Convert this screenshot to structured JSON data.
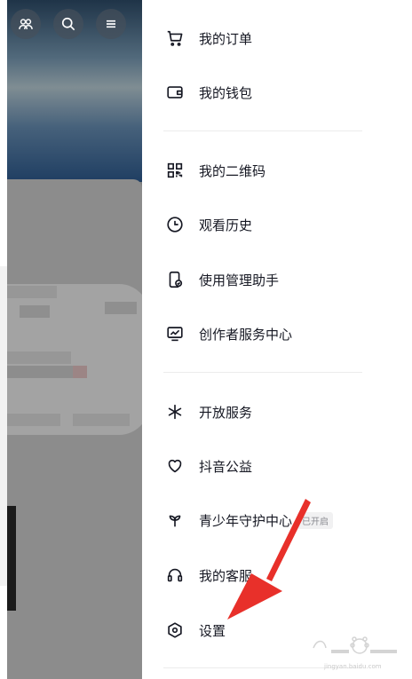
{
  "top_icons": [
    {
      "name": "friends-icon"
    },
    {
      "name": "search-icon"
    },
    {
      "name": "menu-icon"
    }
  ],
  "menu": {
    "group1": [
      {
        "id": "orders",
        "label": "我的订单",
        "icon": "cart-icon"
      },
      {
        "id": "wallet",
        "label": "我的钱包",
        "icon": "wallet-icon"
      }
    ],
    "group2": [
      {
        "id": "qrcode",
        "label": "我的二维码",
        "icon": "qrcode-icon"
      },
      {
        "id": "history",
        "label": "观看历史",
        "icon": "clock-icon"
      },
      {
        "id": "usage",
        "label": "使用管理助手",
        "icon": "phone-check-icon"
      },
      {
        "id": "creator",
        "label": "创作者服务中心",
        "icon": "monitor-chart-icon"
      }
    ],
    "group3": [
      {
        "id": "open-service",
        "label": "开放服务",
        "icon": "asterisk-icon"
      },
      {
        "id": "charity",
        "label": "抖音公益",
        "icon": "heart-icon"
      },
      {
        "id": "youth",
        "label": "青少年守护中心",
        "icon": "sprout-icon",
        "badge": "已开启"
      },
      {
        "id": "support",
        "label": "我的客服",
        "icon": "headset-icon"
      },
      {
        "id": "settings",
        "label": "设置",
        "icon": "hexagon-settings-icon"
      }
    ]
  },
  "annotation": {
    "arrow_color": "#e8302a"
  },
  "watermark": {
    "text": "jingyan.baidu.com"
  }
}
